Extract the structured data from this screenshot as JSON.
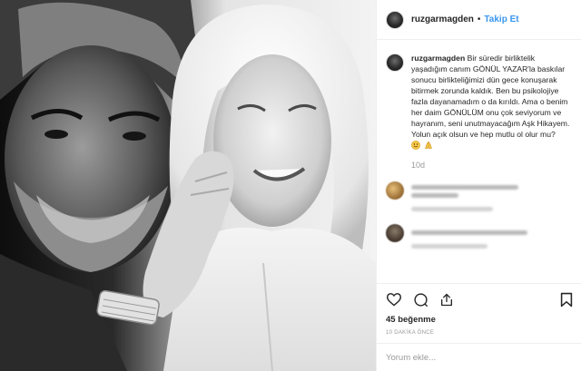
{
  "post": {
    "photo_description_icon": "photo"
  },
  "header": {
    "username": "ruzgarmagden",
    "separator": "•",
    "follow_label": "Takip Et"
  },
  "caption": {
    "username": "ruzgarmagden",
    "text": "Bir süredir birliktelik yaşadığım canım GÖNÜL YAZAR'la baskılar sonucu birlikteliğimizi dün gece konuşarak bitirmek zorunda kaldık. Ben bu psikolojiye fazla dayanamadım o da kırıldı. Ama o benim her daim GÖNÜLÜM onu çok seviyorum ve hayranım, seni unutmayacağım Aşk Hikayem. Yolun açık olsun ve hep mutlu ol olur mu?",
    "emojis": [
      "smiling-face-icon",
      "folded-hands-icon"
    ],
    "time": "10d"
  },
  "actions": {
    "like_icon": "heart-icon",
    "comment_icon": "comment-icon",
    "share_icon": "share-icon",
    "save_icon": "bookmark-icon",
    "likes": "45 beğenme",
    "ago": "10 DAKİKA ÖNCE"
  },
  "comment_box": {
    "placeholder": "Yorum ekle..."
  }
}
